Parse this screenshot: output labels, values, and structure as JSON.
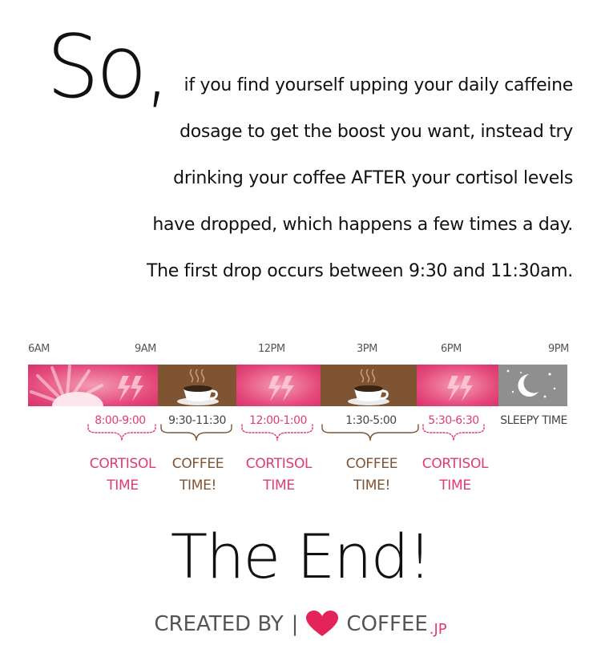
{
  "heading": "So,",
  "intro_lines": [
    "if you find yourself upping your daily caffeine",
    "dosage to get the boost you want, instead try",
    "drinking your coffee AFTER your cortisol levels",
    "have dropped, which happens a few times a day.",
    "The first drop occurs between 9:30 and 11:30am."
  ],
  "timeline": {
    "ticks": [
      "6AM",
      "9AM",
      "12PM",
      "3PM",
      "6PM",
      "9PM"
    ],
    "segments": [
      {
        "type": "cortisol",
        "range": "8:00-9:00",
        "label_line1": "CORTISOL",
        "label_line2": "TIME"
      },
      {
        "type": "coffee",
        "range": "9:30-11:30",
        "label_line1": "COFFEE",
        "label_line2": "TIME!"
      },
      {
        "type": "cortisol",
        "range": "12:00-1:00",
        "label_line1": "CORTISOL",
        "label_line2": "TIME"
      },
      {
        "type": "coffee",
        "range": "1:30-5:00",
        "label_line1": "COFFEE",
        "label_line2": "TIME!"
      },
      {
        "type": "cortisol",
        "range": "5:30-6:30",
        "label_line1": "CORTISOL",
        "label_line2": "TIME"
      },
      {
        "type": "sleep",
        "label": "SLEEPY TIME"
      }
    ],
    "colors": {
      "cortisol": "#e4477a",
      "coffee": "#7e5432",
      "sleep": "#8f8f8f"
    }
  },
  "ending": "The End!",
  "credit": {
    "created_by": "CREATED BY",
    "separator": "|",
    "brand": "COFFEE",
    "brand_suffix": ".JP",
    "heart_icon": "heart-icon",
    "heart_color": "#e3245a"
  }
}
